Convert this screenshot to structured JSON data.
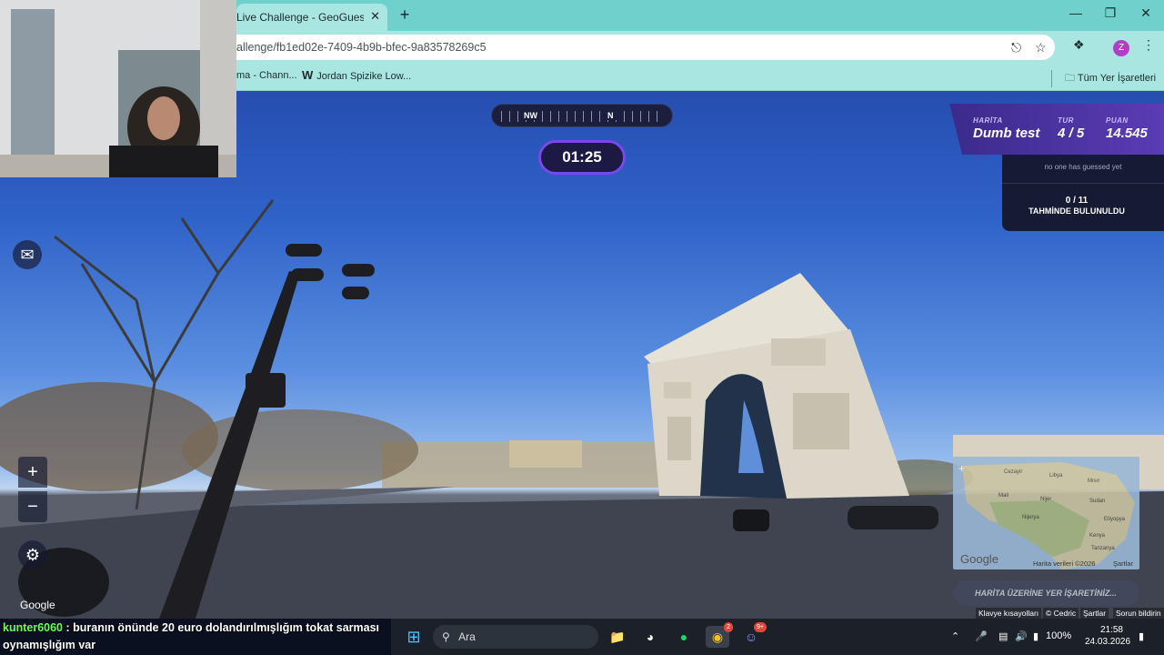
{
  "browser": {
    "tab_title": "Live Challenge - GeoGuessr",
    "tab_close": "✕",
    "new_tab": "+",
    "url": "allenge/fb1ed02e-7409-4b9b-bfec-9a83578269c5",
    "profile_initial": "Z",
    "bookmarks": [
      {
        "label": "ma - Chann..."
      },
      {
        "logo": "W",
        "label": "Jordan Spizike Low..."
      }
    ],
    "all_bookmarks": "Tüm Yer İşaretleri"
  },
  "hud": {
    "compass": {
      "nw": "NW",
      "n": "N"
    },
    "timer": "01:25",
    "status": {
      "map_label": "HARİTA",
      "map_value": "Dumb test",
      "round_label": "TUR",
      "round_value": "4 / 5",
      "score_label": "PUAN",
      "score_value": "14.545"
    },
    "guesses": {
      "none_guessed": "no one has guessed yet",
      "count": "0 / 11",
      "found_text": "TAHMİNDE BULUNULDU"
    },
    "zoom_in": "+",
    "zoom_out": "−",
    "google_watermark": "Google",
    "minimap": {
      "google": "Google",
      "data_credit": "Harita verileri ©2026",
      "terms": "Şartlar",
      "labels": [
        "Cezayir",
        "Libya",
        "Mısır",
        "Nijerya",
        "Kenya",
        "Tanzanya",
        "Etiyopya",
        "Mali",
        "Nijer",
        "Sudan"
      ]
    },
    "map_guess_button": "HARİTA ÜZERİNE YER İŞARETİNİZ...",
    "footer": [
      "Klavye kısayolları",
      "© Cedric",
      "Şartlar",
      "Sorun bildirin"
    ]
  },
  "chat": {
    "user": "kunter6060",
    "message": " : buranın önünde 20 euro dolandırılmışlığım tokat sarması oynamışlığım var"
  },
  "taskbar": {
    "search_placeholder": "Ara",
    "battery": "100%",
    "time": "21:58",
    "date": "24.03.2026",
    "chrome_badge": "2",
    "discord_badge": "9+"
  }
}
